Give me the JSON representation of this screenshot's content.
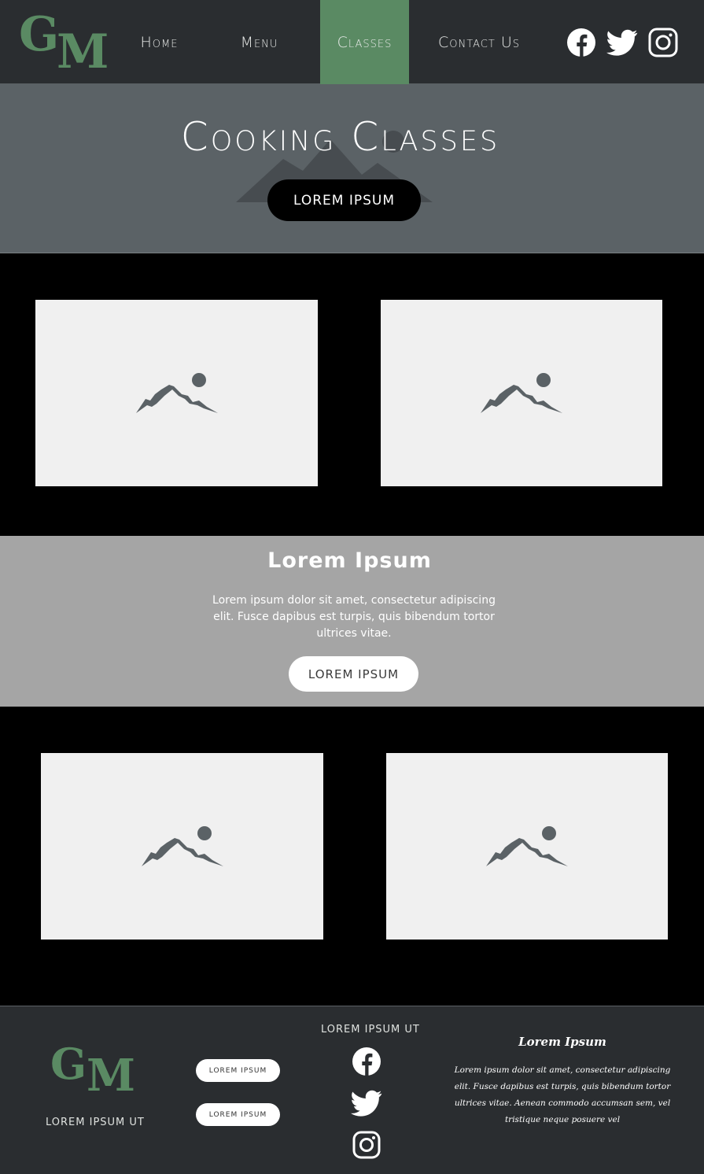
{
  "nav": {
    "logo": {
      "letter1": "G",
      "letter2": "M"
    },
    "links": [
      {
        "label": "Home"
      },
      {
        "label": "Menu"
      },
      {
        "label": "Classes",
        "active": true
      },
      {
        "label": "Contact Us"
      }
    ],
    "social": [
      "facebook-icon",
      "twitter-icon",
      "instagram-icon"
    ]
  },
  "hero": {
    "title": "Cooking Classes",
    "button": "LOREM IPSUM"
  },
  "gallery_top": [
    "image-placeholder-icon",
    "image-placeholder-icon"
  ],
  "band": {
    "title": "Lorem Ipsum",
    "text": "Lorem ipsum dolor sit amet, consectetur adipiscing elit. Fusce dapibus est turpis, quis bibendum tortor ultrices vitae.",
    "button": "LOREM IPSUM"
  },
  "gallery_bottom": [
    "image-placeholder-icon",
    "image-placeholder-icon"
  ],
  "footer": {
    "logo": {
      "letter1": "G",
      "letter2": "M"
    },
    "logo_caption": "LOREM IPSUM UT",
    "buttons": [
      "LOREM IPSUM",
      "LOREM IPSUM"
    ],
    "social_heading": "LOREM IPSUM UT",
    "social": [
      "facebook-icon",
      "twitter-icon",
      "instagram-icon"
    ],
    "script_title": "Lorem Ipsum",
    "script_text": "Lorem ipsum dolor sit amet, consectetur adipiscing elit. Fusce dapibus est turpis, quis bibendum tortor ultrices vitae. Aenean commodo accumsan sem, vel tristique neque posuere vel"
  },
  "colors": {
    "nav_bg": "#2a2d30",
    "accent_green": "#5a8a63",
    "hero_bg": "#5b6266",
    "band_bg": "#a5a5a5",
    "placeholder_bg": "#f0f0f0",
    "placeholder_icon": "#5b6266"
  }
}
